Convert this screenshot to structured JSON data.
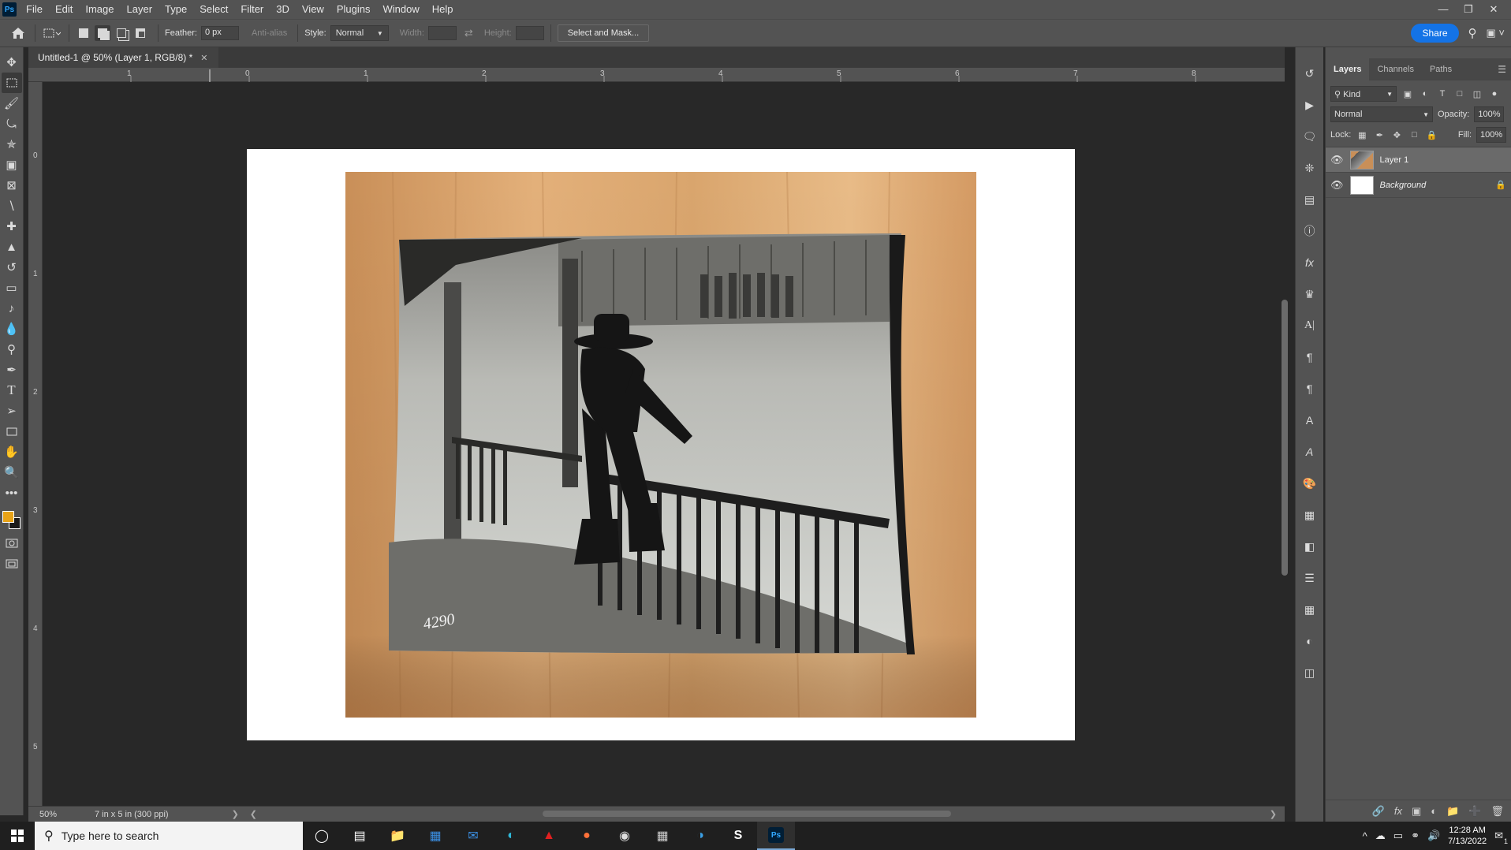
{
  "app": {
    "logo": "Ps",
    "menu": [
      "File",
      "Edit",
      "Image",
      "Layer",
      "Type",
      "Select",
      "Filter",
      "3D",
      "View",
      "Plugins",
      "Window",
      "Help"
    ],
    "window_controls": [
      "minimize-icon",
      "restore-icon",
      "close-icon"
    ]
  },
  "options": {
    "feather_label": "Feather:",
    "feather_value": "0 px",
    "antialias_label": "Anti-alias",
    "style_label": "Style:",
    "style_value": "Normal",
    "width_label": "Width:",
    "height_label": "Height:",
    "select_mask_label": "Select and Mask...",
    "share_label": "Share"
  },
  "document": {
    "tab_title": "Untitled-1 @ 50% (Layer 1, RGB/8) *",
    "zoom": "50%",
    "doc_info": "7 in x 5 in (300 ppi)",
    "ruler_top": [
      "1",
      "0",
      "1",
      "2",
      "3",
      "4",
      "5",
      "6",
      "7",
      "8"
    ],
    "ruler_left": [
      "0",
      "1",
      "2",
      "3",
      "4",
      "5"
    ],
    "photo_caption": "4290"
  },
  "layers_panel": {
    "tabs": [
      "Layers",
      "Channels",
      "Paths"
    ],
    "active_tab": "Layers",
    "filter_kind": "Kind",
    "blend_mode": "Normal",
    "opacity_label": "Opacity:",
    "opacity_value": "100%",
    "lock_label": "Lock:",
    "fill_label": "Fill:",
    "fill_value": "100%",
    "layers": [
      {
        "name": "Layer 1",
        "selected": true,
        "locked": false
      },
      {
        "name": "Background",
        "selected": false,
        "locked": true
      }
    ]
  },
  "taskbar": {
    "search_placeholder": "Type here to search",
    "time": "12:28 AM",
    "date": "7/13/2022",
    "notification_count": "1"
  },
  "colors": {
    "foreground": "#e8a317",
    "background": "#1a1a1a",
    "accent": "#1473e6"
  }
}
